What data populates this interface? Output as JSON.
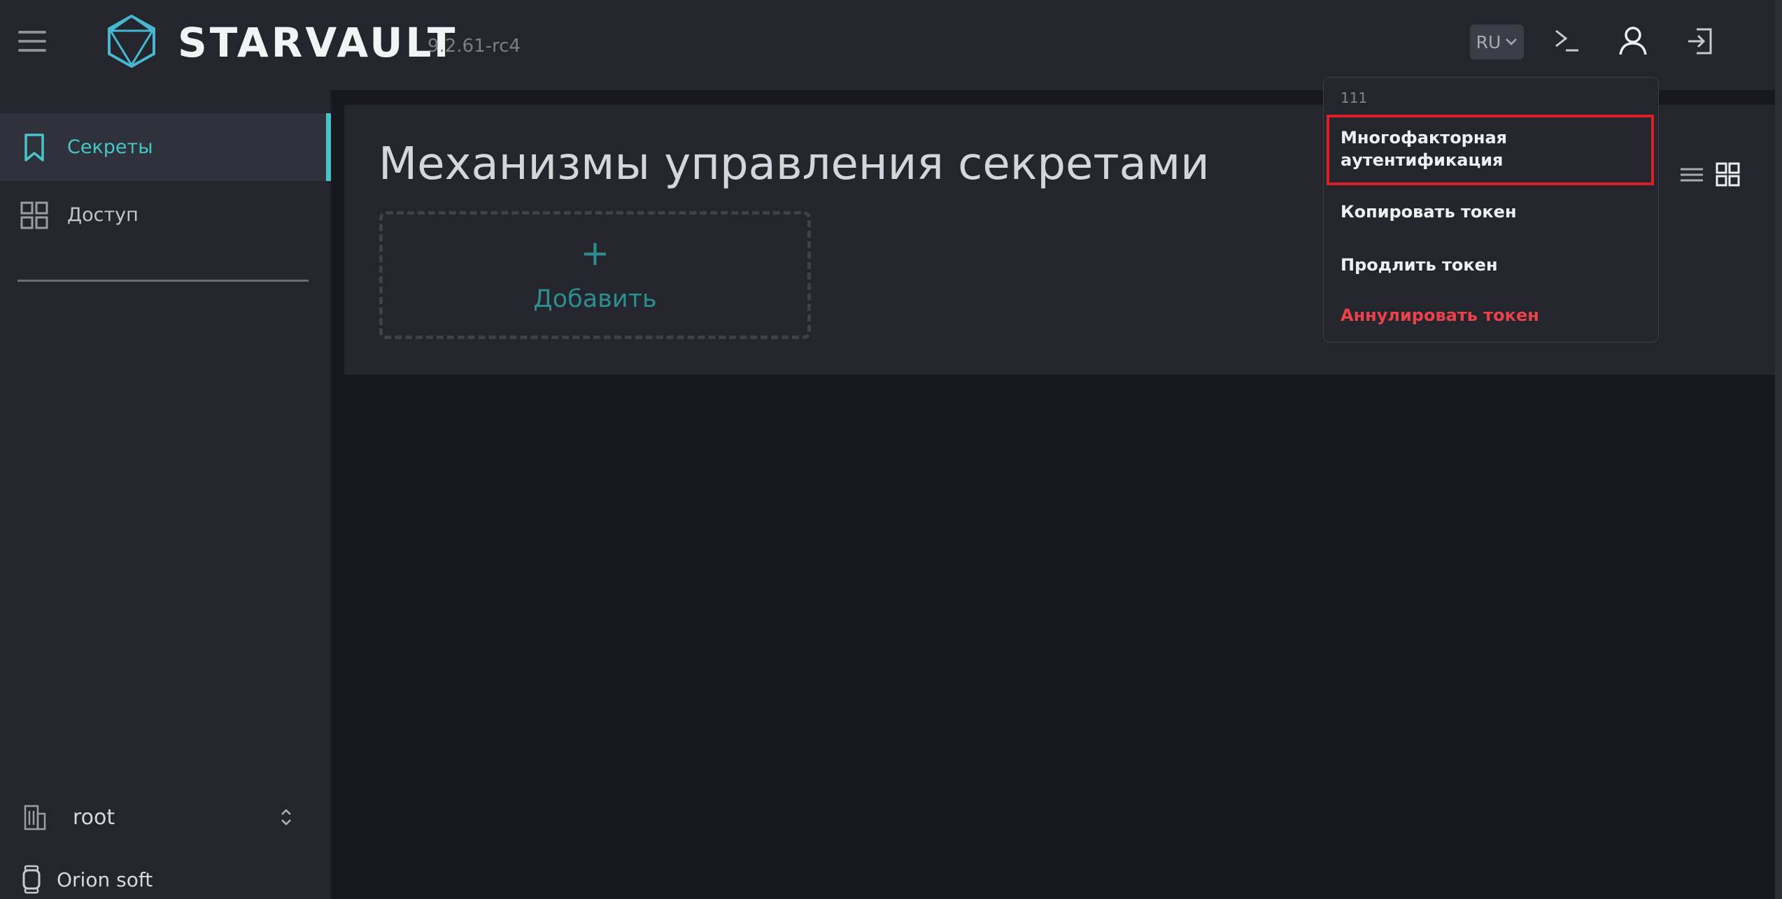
{
  "header": {
    "brand": "STARVAULT",
    "version": "9.2.61-rc4",
    "language": "RU"
  },
  "sidebar": {
    "items": [
      {
        "label": "Секреты",
        "icon": "bookmark-icon",
        "active": true
      },
      {
        "label": "Доступ",
        "icon": "grid-icon",
        "active": false
      }
    ],
    "namespace": "root",
    "organization": "Orion soft"
  },
  "main": {
    "title": "Механизмы управления секретами",
    "add_plus": "+",
    "add_label": "Добавить"
  },
  "user_menu": {
    "username": "111",
    "items": [
      {
        "label_line1": "Многофакторная",
        "label_line2": "аутентификация",
        "highlighted": true
      },
      {
        "label": "Копировать токен"
      },
      {
        "label": "Продлить токен"
      },
      {
        "label": "Аннулировать токен",
        "danger": true
      }
    ]
  },
  "colors": {
    "accent": "#48c5c9",
    "add_text": "#2b8f91",
    "danger": "#e8424a",
    "highlight_border": "#dc1f26",
    "panel_bg": "#25262d",
    "page_bg": "#18191e"
  }
}
